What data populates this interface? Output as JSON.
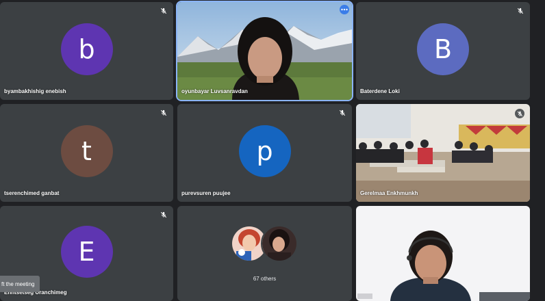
{
  "colors": {
    "background": "#202124",
    "tile": "#3c4043",
    "avatar_purple": "#5e35b1",
    "avatar_periwinkle": "#5c6bc0",
    "avatar_brown": "#6d4c41",
    "avatar_blue": "#1565c0"
  },
  "participants": [
    {
      "name": "byambakhishig enebish",
      "initial": "b",
      "muted": true
    },
    {
      "name": "oyunbayar Luvsanravdan",
      "video": true,
      "pinned": true
    },
    {
      "name": "Baterdene Loki",
      "initial": "B",
      "muted": true
    },
    {
      "name": "tserenchimed ganbat",
      "initial": "t",
      "muted": true
    },
    {
      "name": "purevsuren puujee",
      "initial": "p",
      "muted": true
    },
    {
      "name": "Gerelmaa Enkhmunkh",
      "video": true,
      "muted": true
    },
    {
      "name": "Enhtsetseg Uranchimeg",
      "initial": "E",
      "muted": true
    },
    {
      "name": "",
      "video": true
    }
  ],
  "others": {
    "label": "67 others"
  },
  "toast": {
    "text": "ft the meeting"
  },
  "icons": {
    "mic_off": "mic-off-icon",
    "more": "more-options-icon"
  }
}
